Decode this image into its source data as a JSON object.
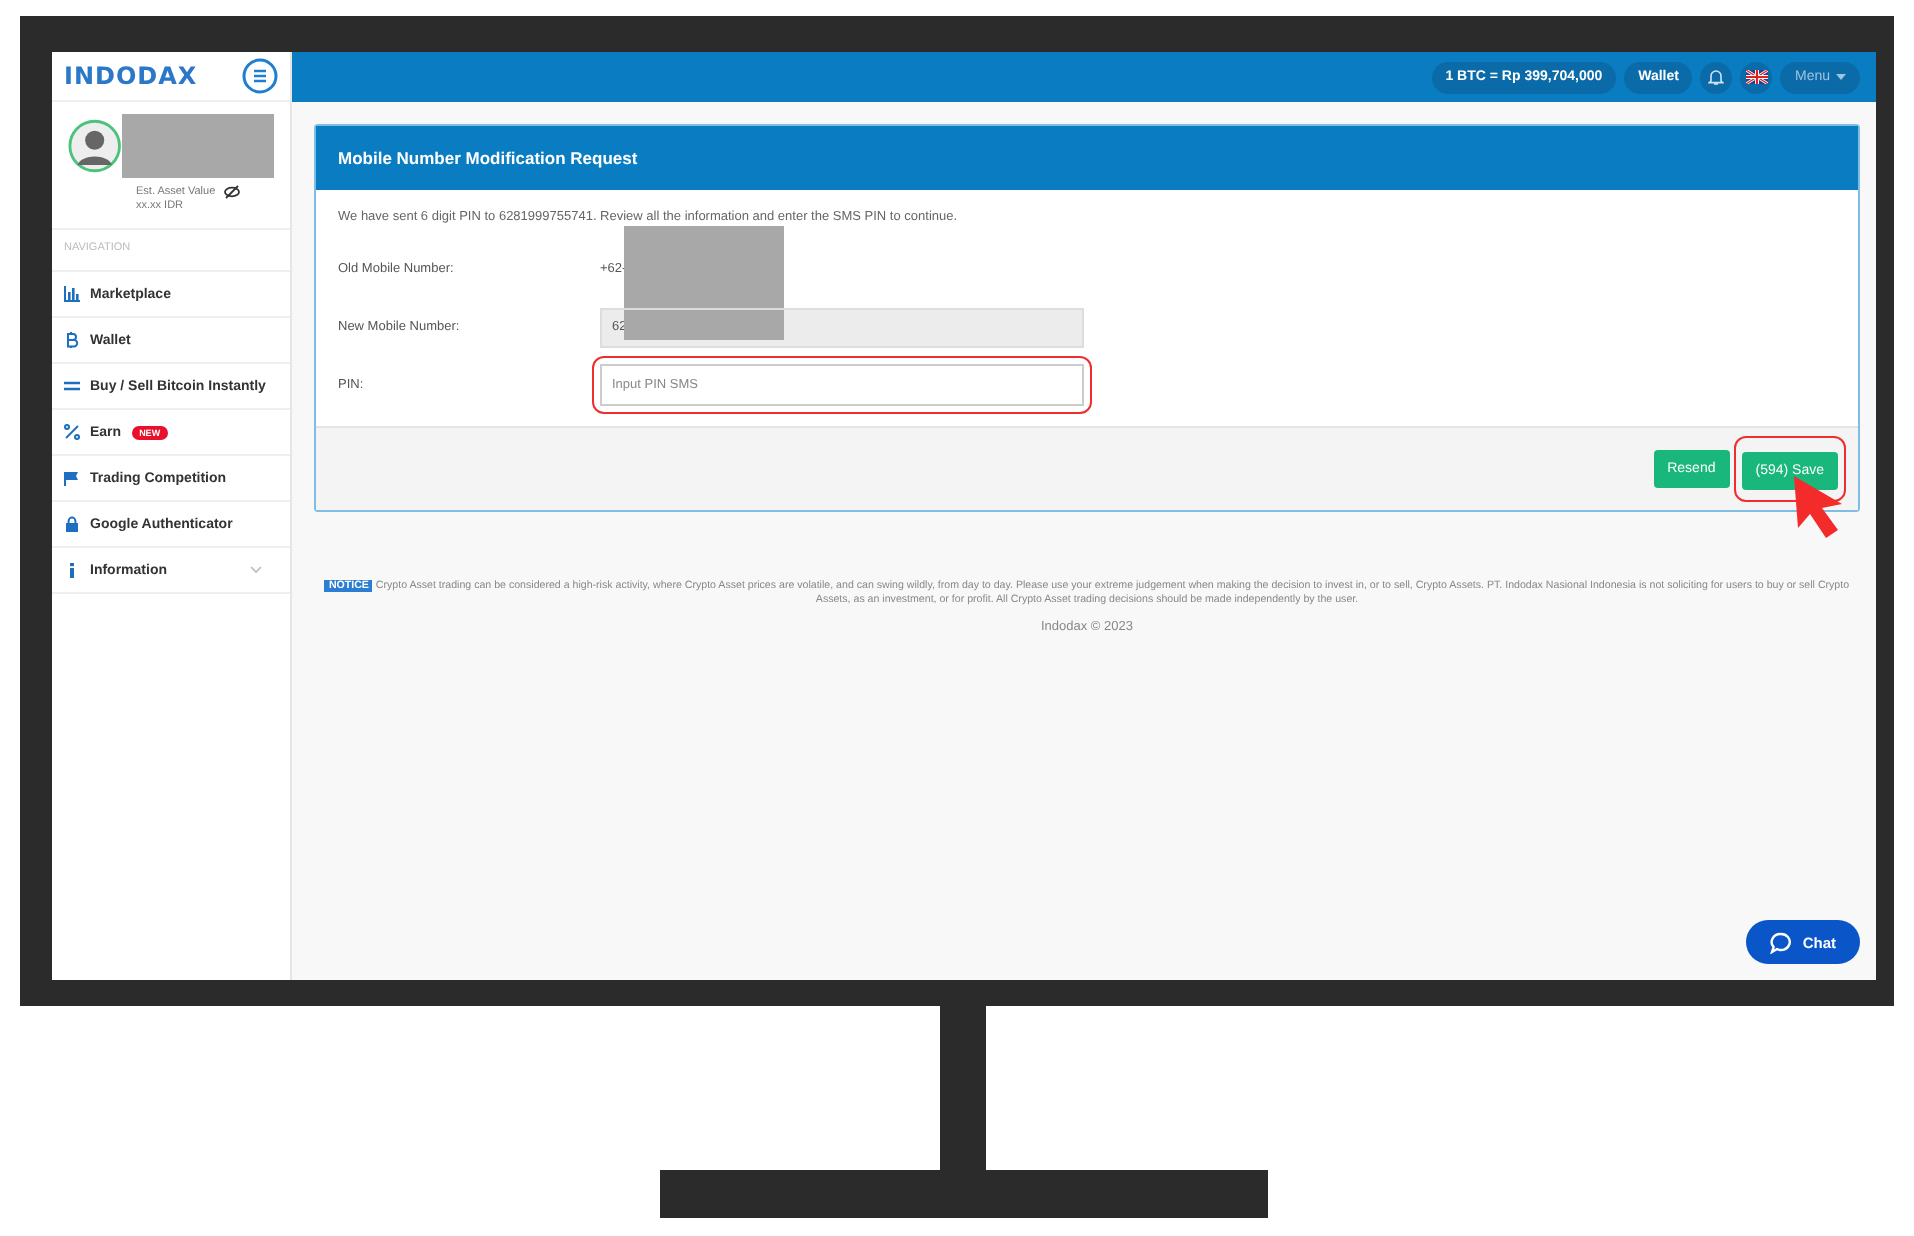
{
  "logo": "INDODAX",
  "topbar": {
    "price": "1 BTC = Rp 399,704,000",
    "wallet": "Wallet",
    "menu": "Menu"
  },
  "profile": {
    "asset_label": "Est. Asset Value",
    "asset_value": "xx.xx IDR"
  },
  "nav_heading": "NAVIGATION",
  "nav": [
    {
      "label": "Marketplace",
      "expandable": false
    },
    {
      "label": "Wallet",
      "expandable": false
    },
    {
      "label": "Buy / Sell Bitcoin Instantly",
      "expandable": false
    },
    {
      "label": "Earn",
      "badge": "NEW",
      "expandable": false
    },
    {
      "label": "Trading Competition",
      "expandable": false
    },
    {
      "label": "Google Authenticator",
      "expandable": false
    },
    {
      "label": "Information",
      "expandable": true
    }
  ],
  "card": {
    "title": "Mobile Number Modification Request",
    "intro": "We have sent 6 digit PIN to 6281999755741. Review all the information and enter the SMS PIN to continue.",
    "fields": [
      {
        "kind": "text",
        "label": "Old Mobile Number:",
        "value": "+62-"
      },
      {
        "kind": "readonly",
        "label": "New Mobile Number:",
        "value": "62"
      },
      {
        "kind": "input",
        "label": "PIN:",
        "placeholder": "Input PIN SMS"
      }
    ],
    "buttons": [
      "Resend",
      "(594) Save"
    ]
  },
  "notice": {
    "badge": "NOTICE",
    "text": "Crypto Asset trading can be considered a high-risk activity, where Crypto Asset prices are volatile, and can swing wildly, from day to day. Please use your extreme judgement when making the decision to invest in, or to sell, Crypto Assets. PT. Indodax Nasional Indonesia is not soliciting for users to buy or sell Crypto Assets, as an investment, or for profit. All Crypto Asset trading decisions should be made independently by the user."
  },
  "copyright": "Indodax © 2023",
  "chat": "Chat"
}
